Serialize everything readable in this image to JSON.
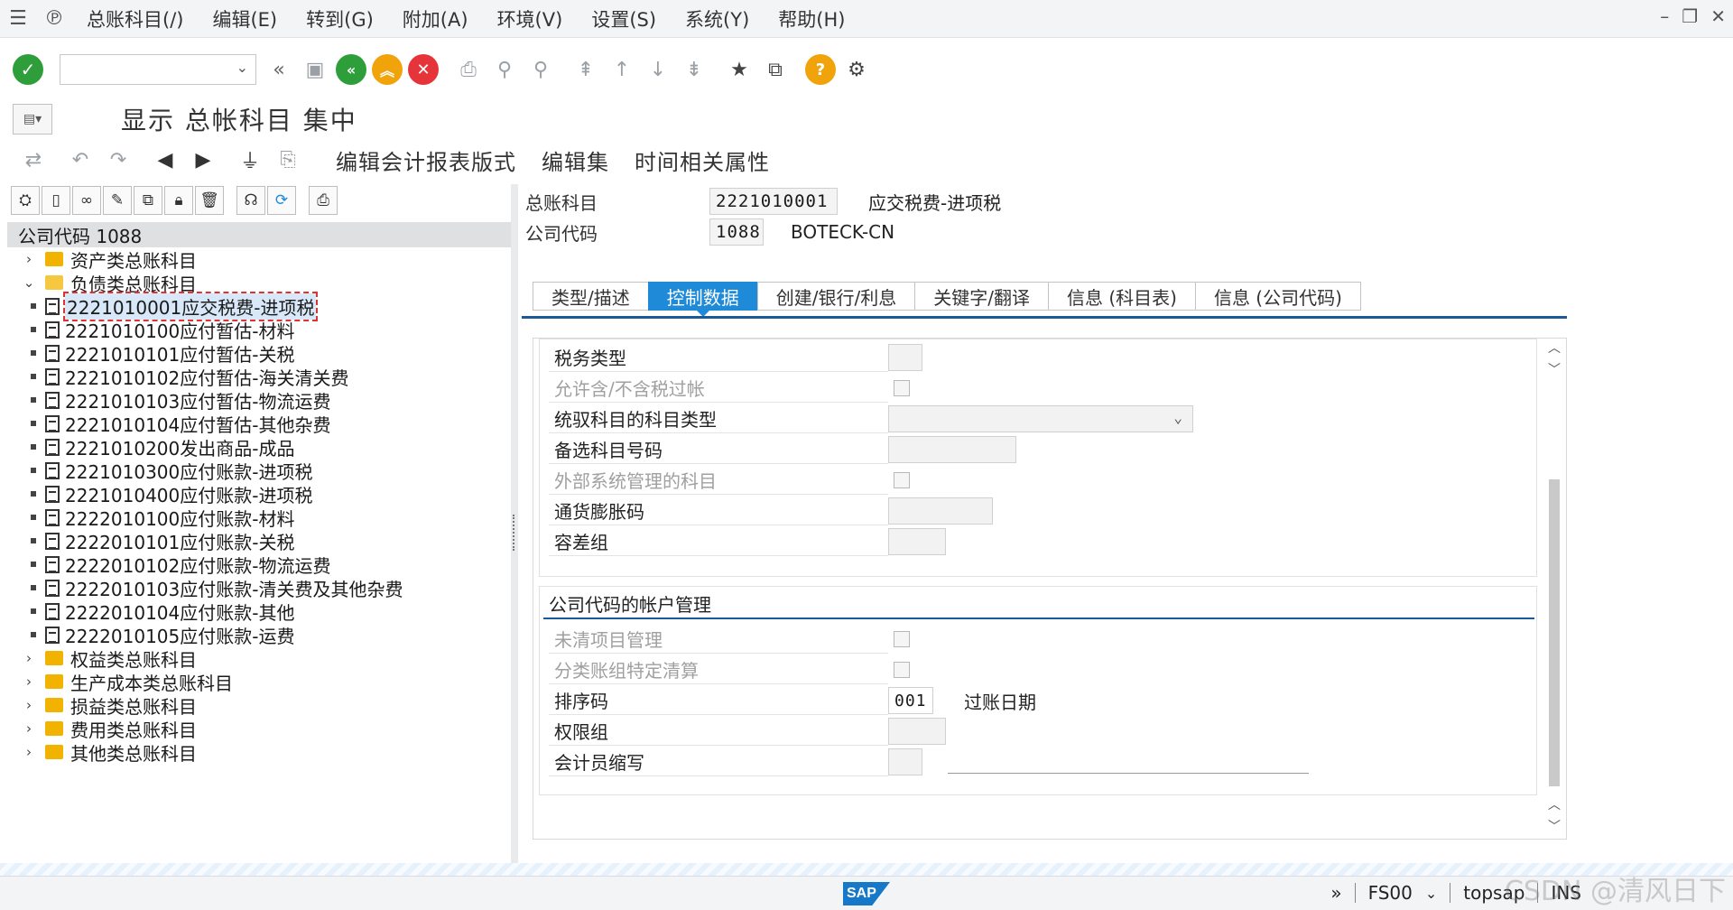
{
  "menu": {
    "items": [
      "总账科目(/)",
      "编辑(E)",
      "转到(G)",
      "附加(A)",
      "环境(V)",
      "设置(S)",
      "系统(Y)",
      "帮助(H)"
    ]
  },
  "toolbar": {
    "command_value": "",
    "icons": [
      "enter-icon",
      "back-double-icon",
      "save-icon",
      "back-icon",
      "exit-icon",
      "cancel-icon",
      "print-icon",
      "find-icon",
      "find-next-icon",
      "first-page-icon",
      "previous-page-icon",
      "next-page-icon",
      "last-page-icon",
      "create-session-icon",
      "shortcut-icon",
      "help-icon",
      "customize-layout-icon"
    ]
  },
  "title": {
    "text": "显示 总帐科目 集中"
  },
  "apptoolbar": {
    "buttons": [
      "编辑会计报表版式",
      "编辑集",
      "时间相关属性"
    ]
  },
  "tree": {
    "header": "公司代码 1088",
    "nodes": [
      {
        "type": "folder",
        "label": "资产类总账科目",
        "expanded": false
      },
      {
        "type": "folder",
        "label": "负债类总账科目",
        "expanded": true
      },
      {
        "type": "leaf",
        "code": "2221010001",
        "name": "应交税费-进项税",
        "selected": true
      },
      {
        "type": "leaf",
        "code": "2221010100",
        "name": "应付暂估-材料"
      },
      {
        "type": "leaf",
        "code": "2221010101",
        "name": "应付暂估-关税"
      },
      {
        "type": "leaf",
        "code": "2221010102",
        "name": "应付暂估-海关清关费"
      },
      {
        "type": "leaf",
        "code": "2221010103",
        "name": "应付暂估-物流运费"
      },
      {
        "type": "leaf",
        "code": "2221010104",
        "name": "应付暂估-其他杂费"
      },
      {
        "type": "leaf",
        "code": "2221010200",
        "name": "发出商品-成品"
      },
      {
        "type": "leaf",
        "code": "2221010300",
        "name": "应付账款-进项税"
      },
      {
        "type": "leaf",
        "code": "2221010400",
        "name": "应付账款-进项税"
      },
      {
        "type": "leaf",
        "code": "2222010100",
        "name": "应付账款-材料"
      },
      {
        "type": "leaf",
        "code": "2222010101",
        "name": "应付账款-关税"
      },
      {
        "type": "leaf",
        "code": "2222010102",
        "name": "应付账款-物流运费"
      },
      {
        "type": "leaf",
        "code": "2222010103",
        "name": "应付账款-清关费及其他杂费"
      },
      {
        "type": "leaf",
        "code": "2222010104",
        "name": "应付账款-其他"
      },
      {
        "type": "leaf",
        "code": "2222010105",
        "name": "应付账款-运费"
      },
      {
        "type": "folder",
        "label": "权益类总账科目",
        "expanded": false
      },
      {
        "type": "folder",
        "label": "生产成本类总账科目",
        "expanded": false
      },
      {
        "type": "folder",
        "label": "损益类总账科目",
        "expanded": false
      },
      {
        "type": "folder",
        "label": "费用类总账科目",
        "expanded": false
      },
      {
        "type": "folder",
        "label": "其他类总账科目",
        "expanded": false
      }
    ]
  },
  "header_fields": {
    "gl_account_label": "总账科目",
    "gl_account_value": "2221010001",
    "gl_account_desc": "应交税费-进项税",
    "company_code_label": "公司代码",
    "company_code_value": "1088",
    "company_code_desc": "BOTECK-CN"
  },
  "tabs": [
    "类型/描述",
    "控制数据",
    "创建/银行/利息",
    "关键字/翻译",
    "信息 (科目表)",
    "信息 (公司代码)"
  ],
  "active_tab": 1,
  "control_group": {
    "tax_category_label": "税务类型",
    "tax_category_value": "",
    "post_without_tax_label": "允许含/不含税过帐",
    "recon_account_label": "统驭科目的科目类型",
    "recon_account_value": "",
    "alt_account_label": "备选科目号码",
    "alt_account_value": "",
    "external_managed_label": "外部系统管理的科目",
    "inflation_key_label": "通货膨胀码",
    "inflation_key_value": "",
    "tolerance_group_label": "容差组",
    "tolerance_group_value": ""
  },
  "account_mgmt_group": {
    "title": "公司代码的帐户管理",
    "open_item_label": "未清项目管理",
    "ledger_group_label": "分类账组特定清算",
    "sort_key_label": "排序码",
    "sort_key_value": "001",
    "sort_key_desc": "过账日期",
    "auth_group_label": "权限组",
    "auth_group_value": "",
    "accounting_clerk_label": "会计员缩写",
    "accounting_clerk_value": ""
  },
  "status": {
    "transaction": "FS00",
    "server": "topsap",
    "mode": "INS"
  },
  "watermark": "CSDN @清风日下"
}
